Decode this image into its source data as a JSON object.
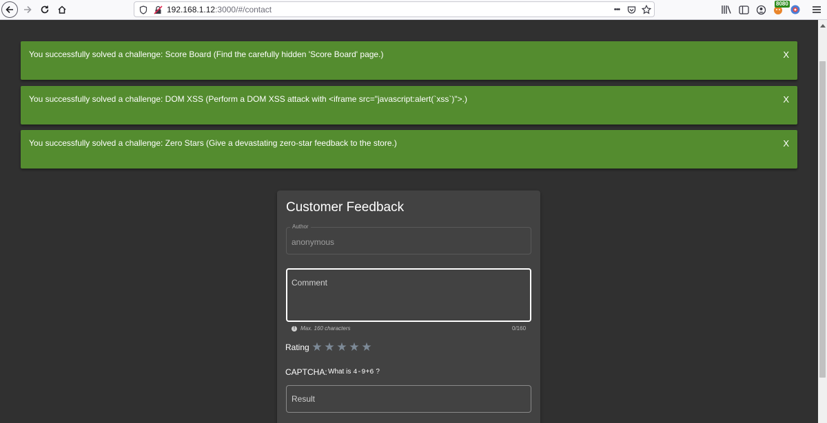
{
  "browser": {
    "url_host": "192.168.1.12",
    "url_path": ":3000/#/contact",
    "badge": "8080",
    "more_label": "•••"
  },
  "notifications": [
    {
      "text": "You successfully solved a challenge: Score Board (Find the carefully hidden 'Score Board' page.)",
      "close": "X"
    },
    {
      "text": "You successfully solved a challenge: DOM XSS (Perform a DOM XSS attack with <iframe src=\"javascript:alert(`xss`)\">.)",
      "close": "X"
    },
    {
      "text": "You successfully solved a challenge: Zero Stars (Give a devastating zero-star feedback to the store.)",
      "close": "X"
    }
  ],
  "feedback": {
    "title": "Customer Feedback",
    "author_label": "Author",
    "author_value": "anonymous",
    "comment_placeholder": "Comment",
    "hint": "Max. 160 characters",
    "counter": "0/160",
    "rating_label": "Rating",
    "rating_value": 0,
    "rating_max": 5,
    "captcha_label": "CAPTCHA:",
    "captcha_prefix": "What is",
    "captcha_expression": "4-9+6",
    "captcha_suffix": "?",
    "result_placeholder": "Result"
  },
  "colors": {
    "notification_bg": "#548c2f",
    "page_bg": "#303030",
    "card_bg": "#424242",
    "star": "#7d8a97"
  }
}
